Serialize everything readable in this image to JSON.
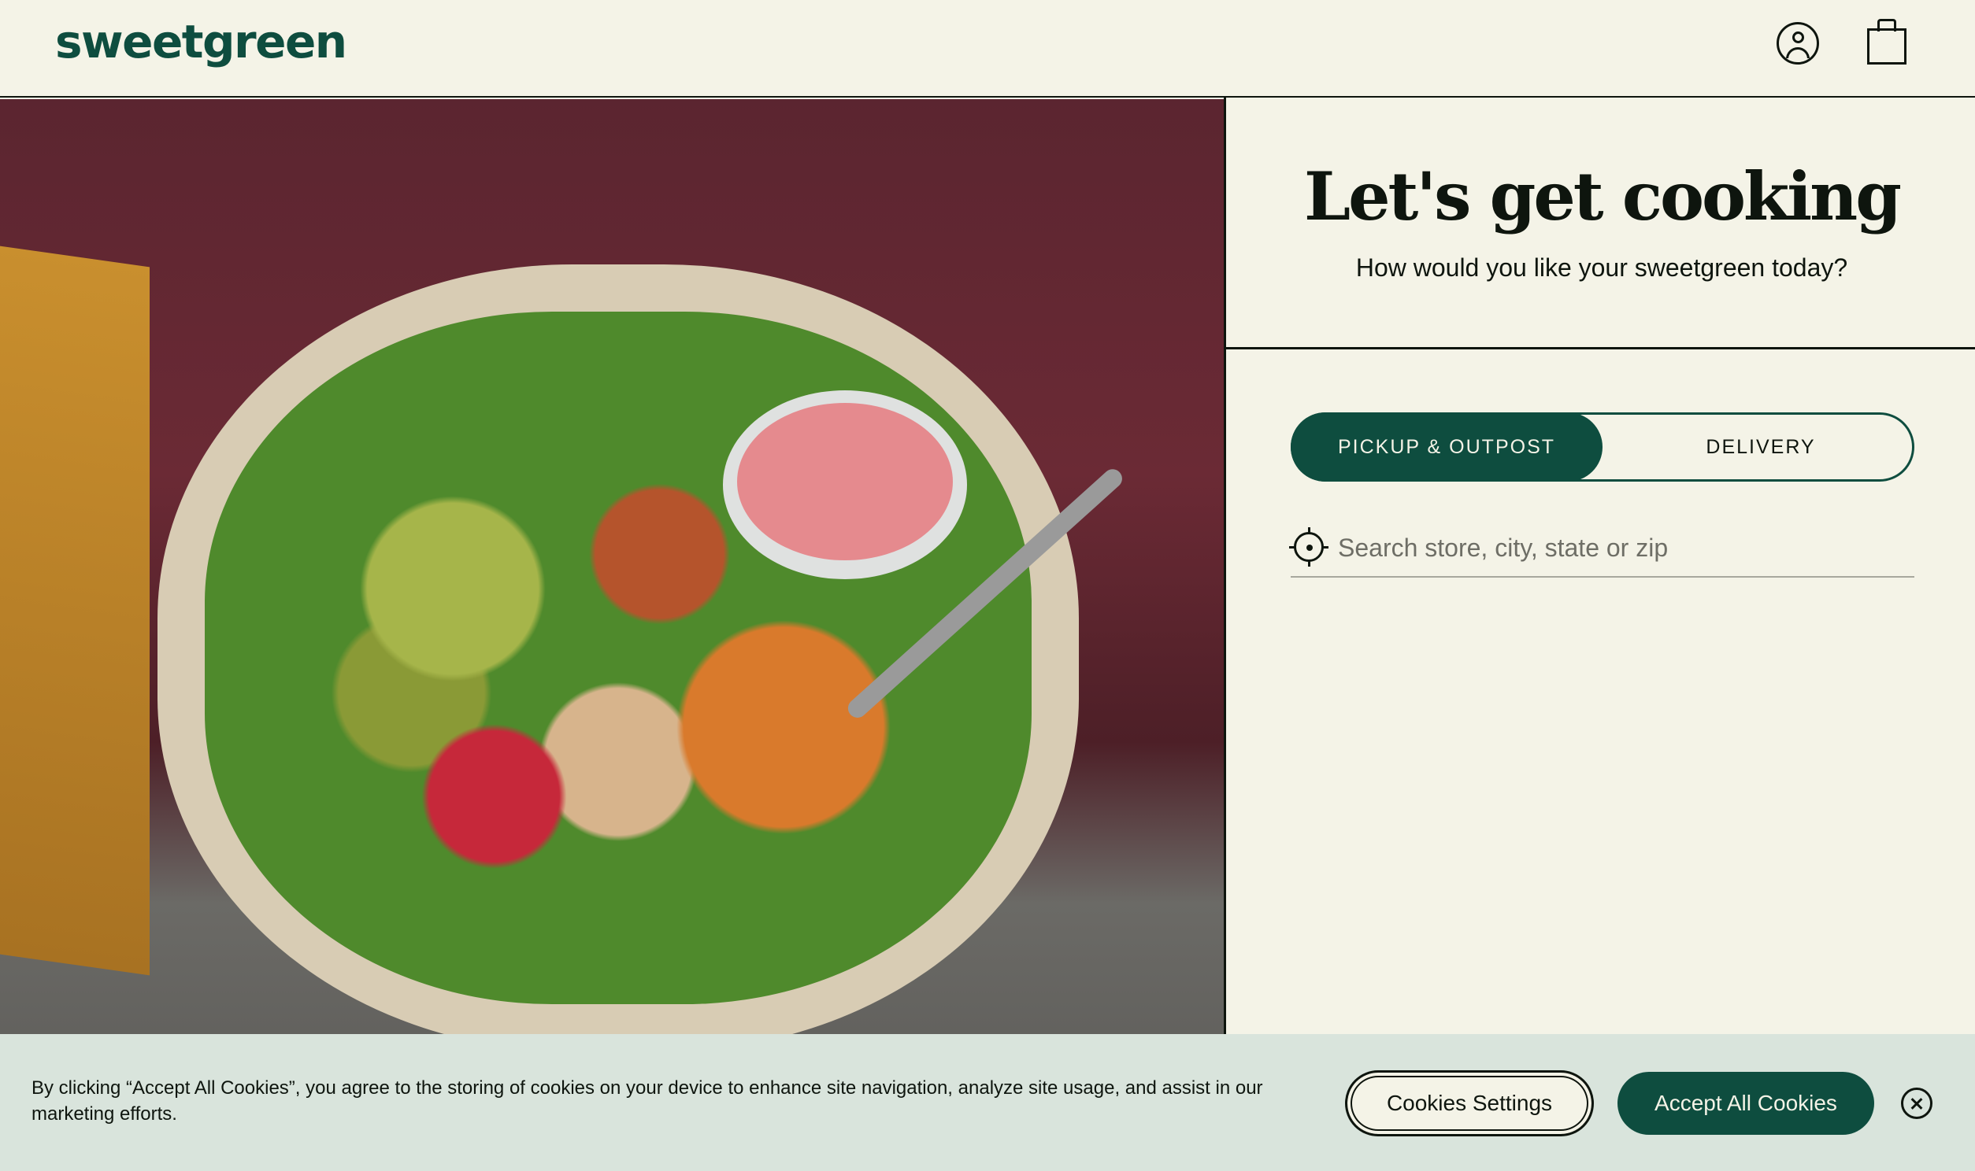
{
  "header": {
    "logo": "sweetgreen",
    "account_icon": "account-icon",
    "bag_icon": "shopping-bag-icon"
  },
  "hero": {
    "image": "photo of a salad bowl held by a person"
  },
  "panel": {
    "title": "Let's get cooking",
    "subtitle": "How would you like your sweetgreen today?",
    "toggle": {
      "options": [
        "PICKUP & OUTPOST",
        "DELIVERY"
      ],
      "selected": "PICKUP & OUTPOST"
    },
    "search": {
      "placeholder": "Search store, city, state or zip",
      "value": "",
      "icon": "locate-icon"
    }
  },
  "cookie_banner": {
    "text": "By clicking “Accept All Cookies”, you agree to the storing of cookies on your device to enhance site navigation, analyze site usage, and assist in our marketing efforts.",
    "settings_label": "Cookies Settings",
    "accept_label": "Accept All Cookies",
    "close_icon": "close-icon"
  },
  "colors": {
    "background": "#f4f3e7",
    "brand_green": "#0e4d3f",
    "text": "#0e150e",
    "cookie_bg": "#d9e4dc"
  }
}
